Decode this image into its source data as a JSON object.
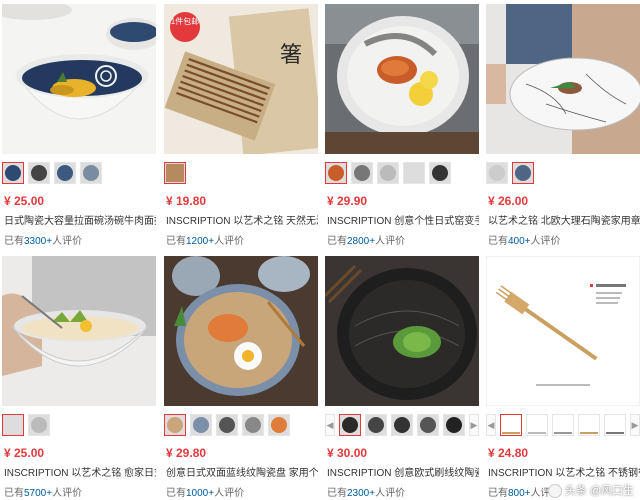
{
  "products": [
    {
      "price": "¥ 25.00",
      "title": "日式陶瓷大容量拉面碗汤碗牛肉面拌",
      "reviews_prefix": "已有",
      "reviews_count": "3300+",
      "reviews_suffix": "人评价"
    },
    {
      "price": "¥ 19.80",
      "title": "INSCRIPTION 以艺术之铭 天然无漆",
      "reviews_prefix": "已有",
      "reviews_count": "1200+",
      "reviews_suffix": "人评价",
      "badge": "1件包邮"
    },
    {
      "price": "¥ 29.90",
      "title": "INSCRIPTION 创意个性日式窑变手",
      "reviews_prefix": "已有",
      "reviews_count": "2800+",
      "reviews_suffix": "人评价"
    },
    {
      "price": "¥ 26.00",
      "title": "以艺术之铭 北欧大理石陶瓷家用章鱼",
      "reviews_prefix": "已有",
      "reviews_count": "400+",
      "reviews_suffix": "人评价"
    },
    {
      "price": "¥ 25.00",
      "title": "INSCRIPTION 以艺术之铭 愈家日式",
      "reviews_prefix": "已有",
      "reviews_count": "5700+",
      "reviews_suffix": "人评价"
    },
    {
      "price": "¥ 29.80",
      "title": "创意日式双面蓝线纹陶瓷盘 家用个性",
      "reviews_prefix": "已有",
      "reviews_count": "1000+",
      "reviews_suffix": "人评价"
    },
    {
      "price": "¥ 30.00",
      "title": "INSCRIPTION 创意欧式刷线纹陶瓷",
      "reviews_prefix": "已有",
      "reviews_count": "2300+",
      "reviews_suffix": "人评价"
    },
    {
      "price": "¥ 24.80",
      "title": "INSCRIPTION 以艺术之铭 不锈钢餐",
      "reviews_prefix": "已有",
      "reviews_count": "800+",
      "reviews_suffix": "人评价"
    }
  ],
  "watermark": "头条 @风口生"
}
